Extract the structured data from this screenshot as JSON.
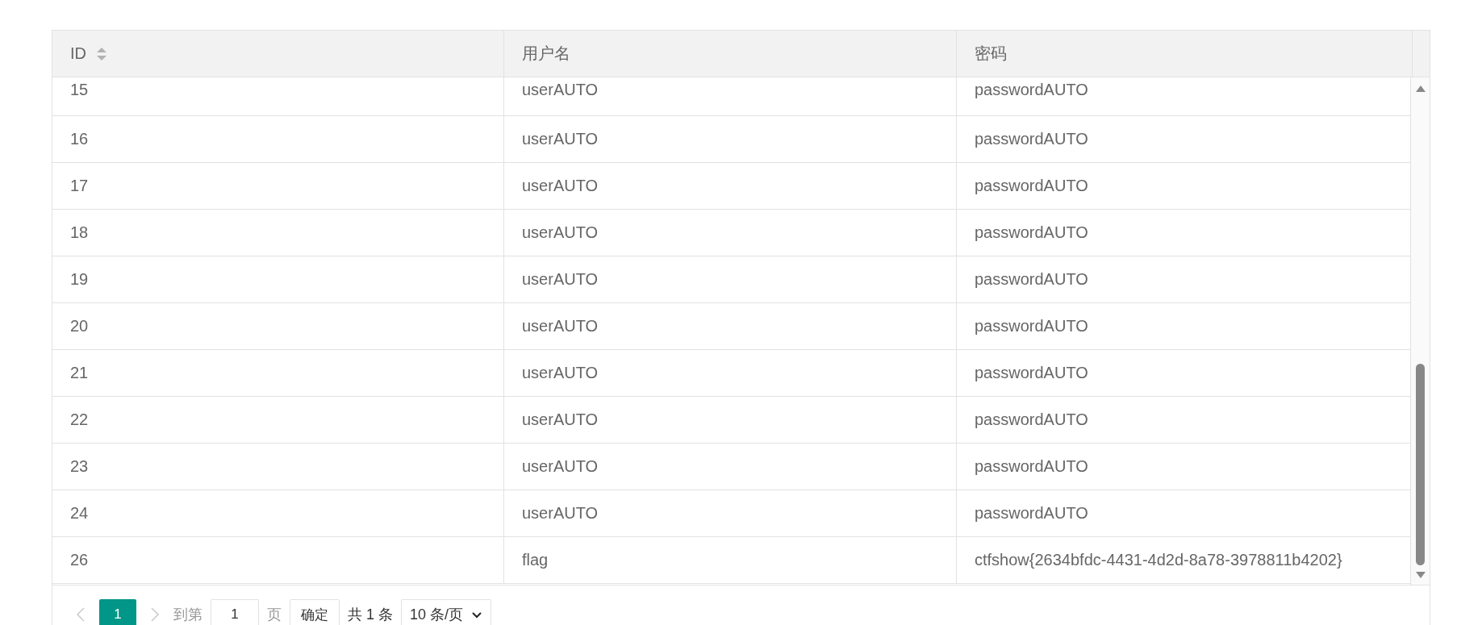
{
  "table": {
    "columns": [
      {
        "label": "ID",
        "sortable": true
      },
      {
        "label": "用户名",
        "sortable": false
      },
      {
        "label": "密码",
        "sortable": false
      }
    ],
    "rows": [
      [
        "15",
        "userAUTO",
        "passwordAUTO"
      ],
      [
        "16",
        "userAUTO",
        "passwordAUTO"
      ],
      [
        "17",
        "userAUTO",
        "passwordAUTO"
      ],
      [
        "18",
        "userAUTO",
        "passwordAUTO"
      ],
      [
        "19",
        "userAUTO",
        "passwordAUTO"
      ],
      [
        "20",
        "userAUTO",
        "passwordAUTO"
      ],
      [
        "21",
        "userAUTO",
        "passwordAUTO"
      ],
      [
        "22",
        "userAUTO",
        "passwordAUTO"
      ],
      [
        "23",
        "userAUTO",
        "passwordAUTO"
      ],
      [
        "24",
        "userAUTO",
        "passwordAUTO"
      ],
      [
        "26",
        "flag",
        "ctfshow{2634bfdc-4431-4d2d-8a78-3978811b4202}"
      ]
    ]
  },
  "pagination": {
    "prev": {
      "disabled": true
    },
    "pages": [
      {
        "label": "1",
        "selected": true
      }
    ],
    "next": {
      "disabled": true
    },
    "goto_label": "到第",
    "goto_value": "1",
    "page_label": "页",
    "confirm": "确定",
    "total": "共 1 条",
    "page_size": "10 条/页"
  }
}
